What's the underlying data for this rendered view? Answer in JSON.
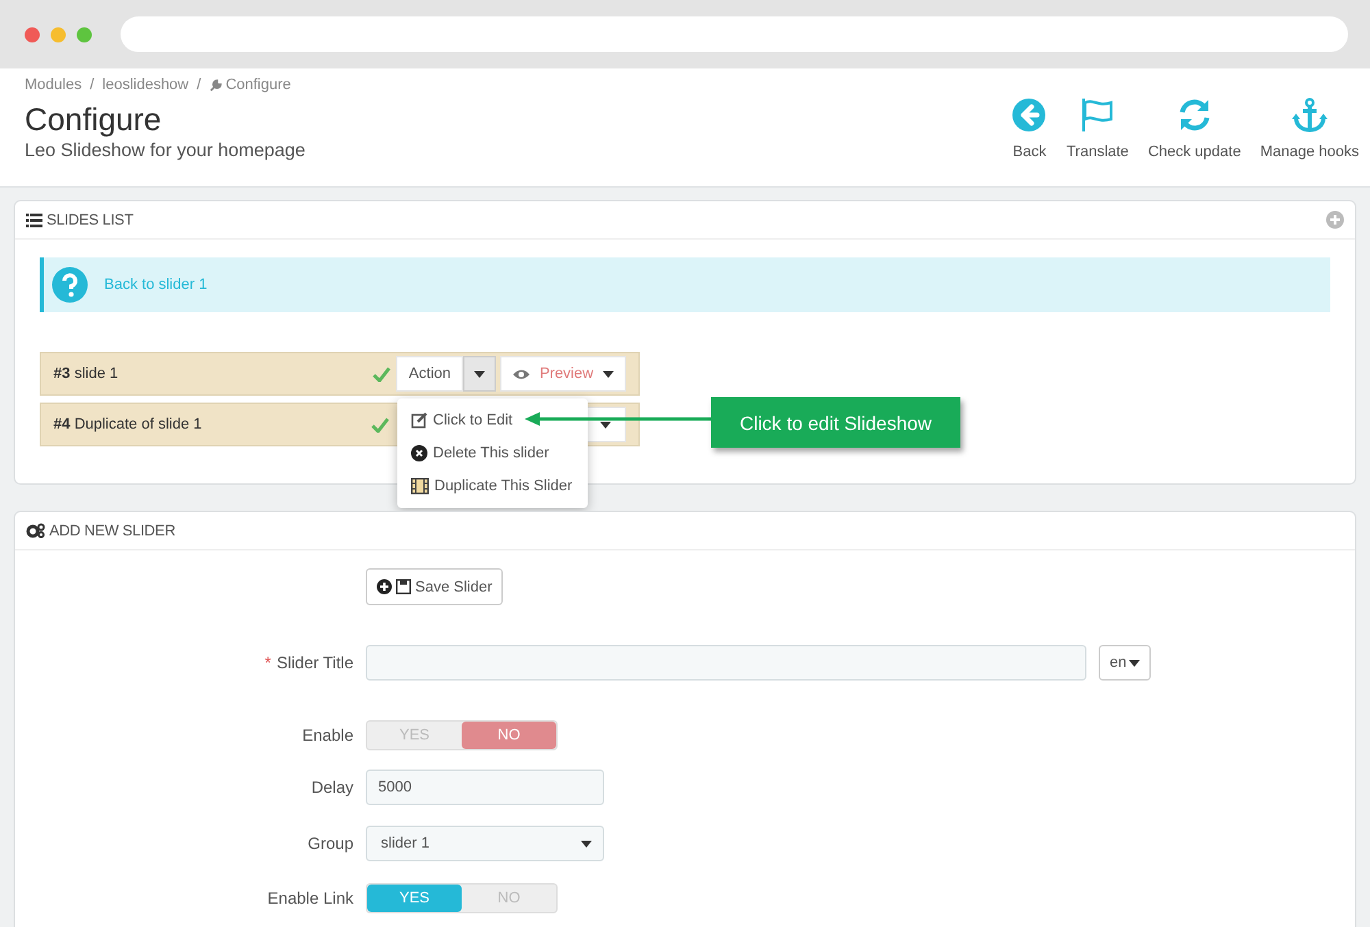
{
  "breadcrumb": [
    {
      "kind": "link",
      "label": "Modules"
    },
    {
      "kind": "separator",
      "label": "/"
    },
    {
      "kind": "link",
      "label": "leoslideshow"
    },
    {
      "kind": "separator",
      "label": "/"
    },
    {
      "kind": "current",
      "label": "Configure"
    }
  ],
  "page": {
    "title": "Configure",
    "subtitle": "Leo Slideshow for your homepage"
  },
  "toolbar": [
    {
      "label": "Back"
    },
    {
      "label": "Translate"
    },
    {
      "label": "Check update"
    },
    {
      "label": "Manage hooks"
    }
  ],
  "slides_panel": {
    "title": "SLIDES LIST",
    "alert": "Back to slider 1",
    "slides": [
      {
        "number": "#3",
        "title": "slide 1",
        "active": true,
        "menu_open": true,
        "action": "Action",
        "preview": "Preview"
      },
      {
        "number": "#4",
        "title": "Duplicate of slide 1",
        "active": true,
        "menu_open": false
      }
    ],
    "action_menu": [
      "Click to Edit",
      "Delete This slider",
      "Duplicate This Slider"
    ],
    "callout": "Click to edit Slideshow"
  },
  "form_panel": {
    "title": "ADD NEW SLIDER",
    "save_button": "Save Slider",
    "fields": [
      {
        "kind": "text",
        "label": "Slider Title",
        "required_mark": "*",
        "language": "en"
      },
      {
        "kind": "switch",
        "label": "Enable",
        "options": [
          {
            "label": "YES",
            "selected": false
          },
          {
            "label": "NO",
            "selected": true
          }
        ]
      },
      {
        "kind": "text",
        "label": "Delay",
        "value": "5000"
      },
      {
        "kind": "select",
        "label": "Group",
        "value": "slider 1"
      },
      {
        "kind": "switch",
        "label": "Enable Link",
        "options": [
          {
            "label": "YES",
            "selected": true
          },
          {
            "label": "NO",
            "selected": false
          }
        ]
      }
    ]
  }
}
